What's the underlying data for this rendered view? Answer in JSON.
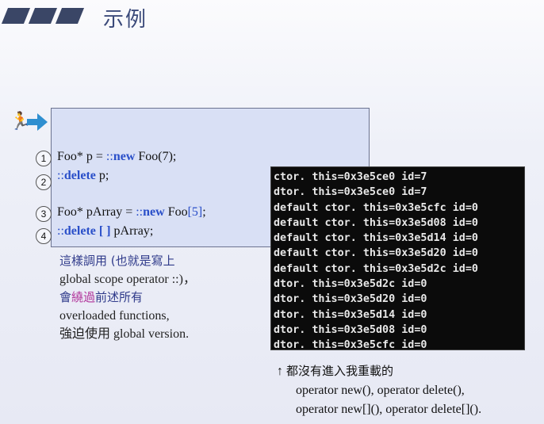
{
  "title": "示例",
  "code": {
    "line1": {
      "num": "1",
      "pre": "Foo* p = ",
      "scope": "::",
      "kw": "new",
      "post": " Foo(7);"
    },
    "line2": {
      "num": "2",
      "scope": "::",
      "kw": "delete",
      "post": " p;"
    },
    "line3": {
      "num": "3",
      "pre": "Foo* pArray = ",
      "scope": "::",
      "kw": "new",
      "post": " Foo",
      "bracket": "[5]",
      "tail": ";"
    },
    "line4": {
      "num": "4",
      "scope": "::",
      "kw": "delete",
      "bracket": " [ ]",
      "post": " pArray;"
    }
  },
  "description": {
    "l1": "這樣調用 (也就是寫上",
    "l2": "global scope operator ::)，",
    "l3a": "會",
    "l3b": "繞過",
    "l3c": "前述所有",
    "l4": "overloaded functions,",
    "l5": "強迫使用 global version."
  },
  "console_lines": [
    "ctor. this=0x3e5ce0 id=7",
    "dtor. this=0x3e5ce0 id=7",
    "default ctor. this=0x3e5cfc id=0",
    "default ctor. this=0x3e5d08 id=0",
    "default ctor. this=0x3e5d14 id=0",
    "default ctor. this=0x3e5d20 id=0",
    "default ctor. this=0x3e5d2c id=0",
    "dtor. this=0x3e5d2c id=0",
    "dtor. this=0x3e5d20 id=0",
    "dtor. this=0x3e5d14 id=0",
    "dtor. this=0x3e5d08 id=0",
    "dtor. this=0x3e5cfc id=0"
  ],
  "note": {
    "arrow": "↑",
    "l1": "都沒有進入我重載的",
    "l2": "operator new(), operator delete(),",
    "l3": "operator new[](), operator delete[]()."
  },
  "colors": {
    "keyword": "#2a4fc9",
    "box": "#d9e0f5",
    "title": "#3b4a7a",
    "highlight": "#b0329a"
  },
  "icons": {
    "runner": "running-person-icon",
    "arrow": "right-arrow-icon"
  }
}
